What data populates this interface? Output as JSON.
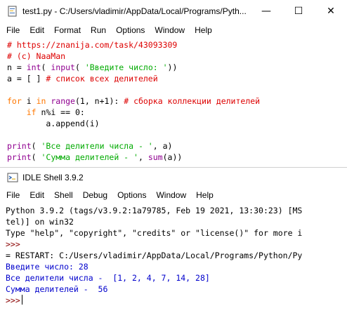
{
  "editor": {
    "title": "test1.py - C:/Users/vladimir/AppData/Local/Programs/Pyth...",
    "controls": {
      "minimize": "—",
      "maximize": "☐",
      "close": "✕"
    },
    "menu": [
      "File",
      "Edit",
      "Format",
      "Run",
      "Options",
      "Window",
      "Help"
    ],
    "code": [
      [
        {
          "t": "# https://znanija.com/task/43093309",
          "c": "comment"
        }
      ],
      [
        {
          "t": "# (c) NaaMan",
          "c": "comment"
        }
      ],
      [
        {
          "t": "n = ",
          "c": "plain"
        },
        {
          "t": "int",
          "c": "builtin"
        },
        {
          "t": "( ",
          "c": "plain"
        },
        {
          "t": "input",
          "c": "builtin"
        },
        {
          "t": "( ",
          "c": "plain"
        },
        {
          "t": "'Введите число: '",
          "c": "string"
        },
        {
          "t": "))",
          "c": "plain"
        }
      ],
      [
        {
          "t": "a = [ ] ",
          "c": "plain"
        },
        {
          "t": "# список всех делителей",
          "c": "comment"
        }
      ],
      [],
      [
        {
          "t": "for",
          "c": "keyword"
        },
        {
          "t": " i ",
          "c": "plain"
        },
        {
          "t": "in",
          "c": "keyword"
        },
        {
          "t": " ",
          "c": "plain"
        },
        {
          "t": "range",
          "c": "builtin"
        },
        {
          "t": "(1, n+1): ",
          "c": "plain"
        },
        {
          "t": "# сборка коллекции делителей",
          "c": "comment"
        }
      ],
      [
        {
          "t": "    ",
          "c": "plain"
        },
        {
          "t": "if",
          "c": "keyword"
        },
        {
          "t": " n%i == 0:",
          "c": "plain"
        }
      ],
      [
        {
          "t": "        a.append(i)",
          "c": "plain"
        }
      ],
      [],
      [
        {
          "t": "print",
          "c": "builtin"
        },
        {
          "t": "( ",
          "c": "plain"
        },
        {
          "t": "'Все делители числа - '",
          "c": "string"
        },
        {
          "t": ", a)",
          "c": "plain"
        }
      ],
      [
        {
          "t": "print",
          "c": "builtin"
        },
        {
          "t": "( ",
          "c": "plain"
        },
        {
          "t": "'Сумма делителей - '",
          "c": "string"
        },
        {
          "t": ", ",
          "c": "plain"
        },
        {
          "t": "sum",
          "c": "builtin"
        },
        {
          "t": "(a))",
          "c": "plain"
        }
      ]
    ]
  },
  "shell": {
    "title": "IDLE Shell 3.9.2",
    "menu": [
      "File",
      "Edit",
      "Shell",
      "Debug",
      "Options",
      "Window",
      "Help"
    ],
    "lines": [
      {
        "t": "Python 3.9.2 (tags/v3.9.2:1a79785, Feb 19 2021, 13:30:23) [MS",
        "c": "plain"
      },
      {
        "t": "tel)] on win32",
        "c": "plain"
      },
      {
        "t": "Type \"help\", \"copyright\", \"credits\" or \"license()\" for more i",
        "c": "plain"
      },
      {
        "t": ">>>",
        "c": "prompt"
      },
      {
        "t": "= RESTART: C:/Users/vladimir/AppData/Local/Programs/Python/Py",
        "c": "restart"
      },
      {
        "t": "Введите число: 28",
        "c": "stdout"
      },
      {
        "t": "Все делители числа -  [1, 2, 4, 7, 14, 28]",
        "c": "stdout"
      },
      {
        "t": "Сумма делителей -  56",
        "c": "stdout"
      }
    ],
    "final_prompt": ">>>"
  },
  "colors": {
    "comment": "#dd0000",
    "keyword": "#ff7700",
    "builtin": "#900090",
    "string": "#00aa00",
    "stdout": "#0000cc",
    "prompt": "#8a0000"
  },
  "icons": {
    "editor": "idle-editor-icon",
    "shell": "idle-shell-icon"
  }
}
